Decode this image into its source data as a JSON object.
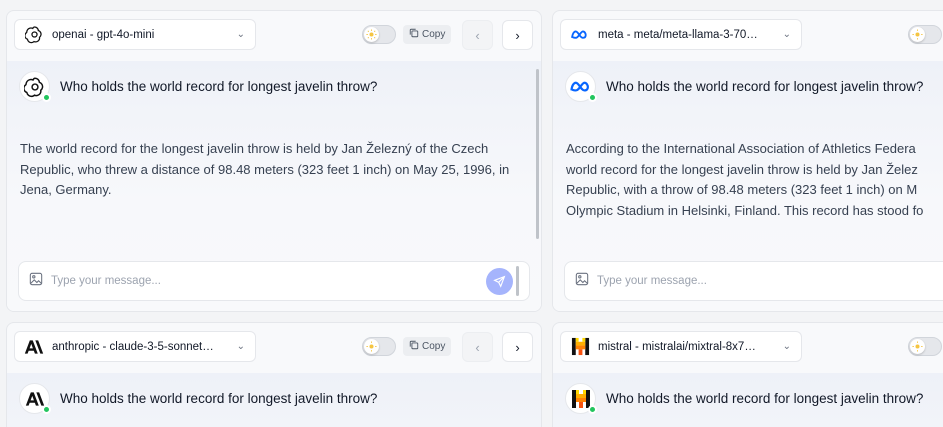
{
  "panels": [
    {
      "provider_model": "openai - gpt-4o-mini",
      "question": "Who holds the world record for longest javelin throw?",
      "answer": "The world record for the longest javelin throw is held by Jan Železný of the Czech Republic, who threw a distance of 98.48 meters (323 feet 1 inch) on May 25, 1996, in Jena, Germany.",
      "copy_label": "Copy",
      "prev_label": "‹",
      "next_label": "›",
      "input_placeholder": "Type your message...",
      "logo_icon": "openai-logo-icon"
    },
    {
      "provider_model": "meta - meta/meta-llama-3-70…",
      "question": "Who holds the world record for longest javelin throw?",
      "answer_lines": [
        "According to the International Association of Athletics Federa",
        "world record for the longest javelin throw is held by Jan Želez",
        "Republic, with a throw of 98.48 meters (323 feet 1 inch) on M",
        "Olympic Stadium in Helsinki, Finland. This record has stood fo"
      ],
      "input_placeholder": "Type your message...",
      "logo_icon": "meta-logo-icon"
    },
    {
      "provider_model": "anthropic - claude-3-5-sonnet…",
      "question": "Who holds the world record for longest javelin throw?",
      "copy_label": "Copy",
      "prev_label": "‹",
      "next_label": "›",
      "logo_icon": "anthropic-logo-icon"
    },
    {
      "provider_model": "mistral - mistralai/mixtral-8x7…",
      "question": "Who holds the world record for longest javelin throw?",
      "logo_icon": "mistral-logo-icon"
    }
  ],
  "colors": {
    "send_button": "#a5b4fc",
    "online_dot": "#22c55e",
    "meta_blue": "#0866ff",
    "mistral_orange": "#fa520f"
  }
}
